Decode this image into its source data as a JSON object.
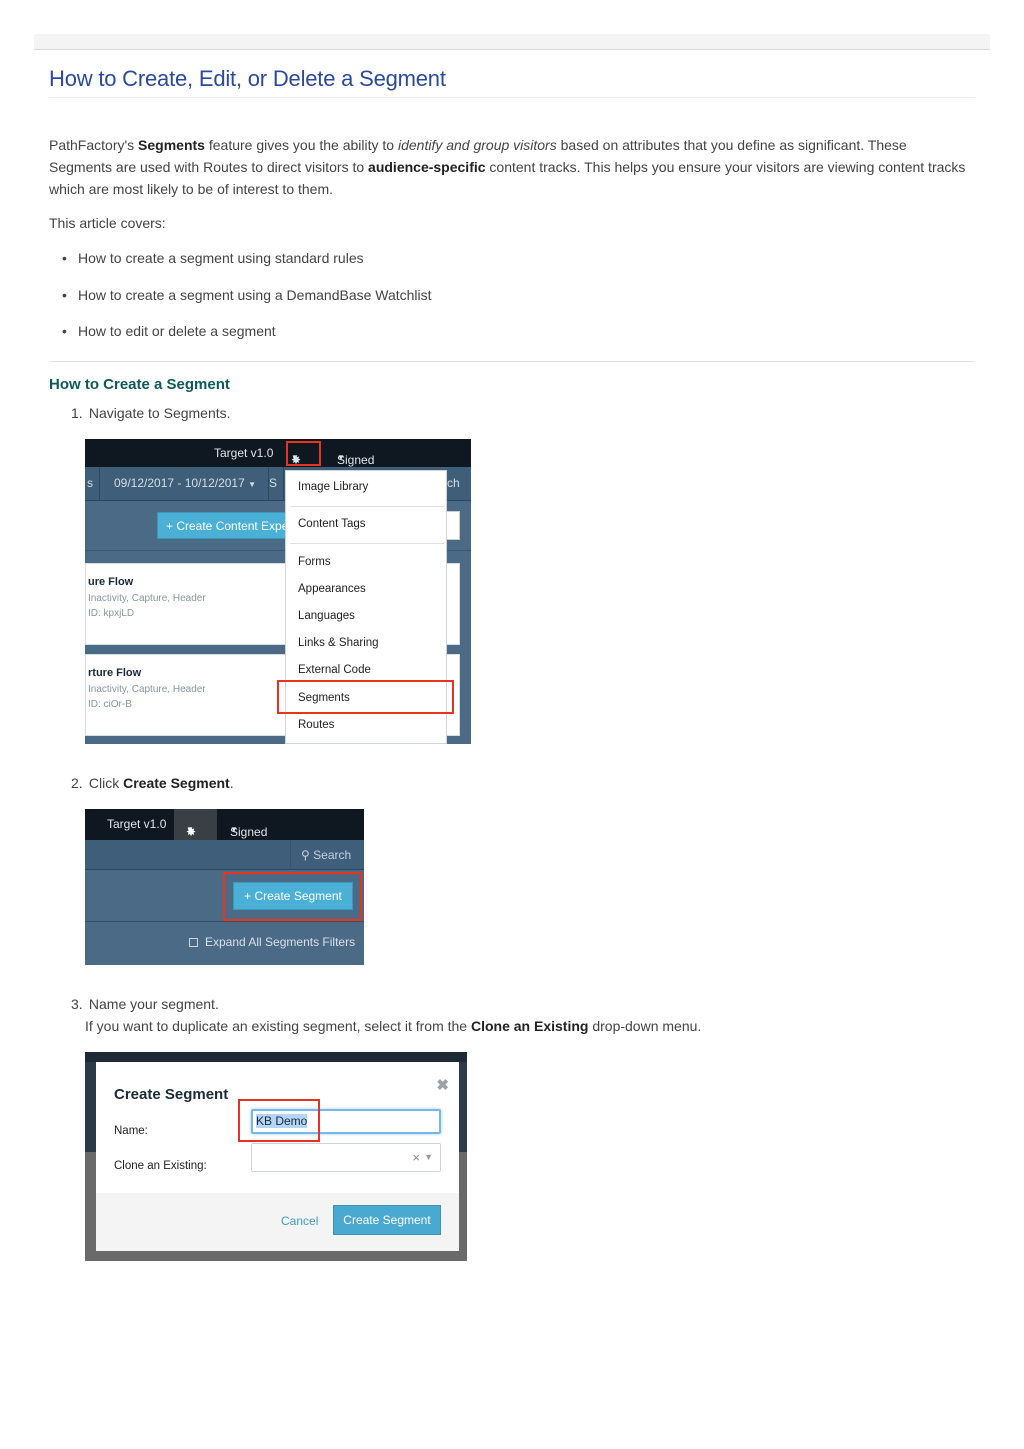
{
  "article": {
    "title": "How to Create, Edit, or Delete a Segment",
    "intro": {
      "t1": "PathFactory's ",
      "b1": "Segments",
      "t2": " feature gives you the ability to ",
      "i1": "identify and group visitors",
      "t3": " based on attributes that you define as significant. These Segments are used with Routes to direct visitors to ",
      "b2": "audience-specific",
      "t4": " content tracks. This helps you ensure your visitors are viewing content tracks which are most likely to be of interest to them."
    },
    "covers_label": "This article covers:",
    "covers": [
      "How to create a segment using standard rules",
      "How to create a segment using a DemandBase Watchlist",
      "How to edit or delete a segment"
    ],
    "section_title": "How to Create a Segment",
    "steps": [
      {
        "num": "1.",
        "text": "Navigate to Segments."
      },
      {
        "num": "2.",
        "pre": "Click ",
        "bold": "Create Segment",
        "post": "."
      },
      {
        "num": "3.",
        "text": "Name your segment.",
        "sub_pre": "If you want to duplicate an existing segment, select it from the ",
        "sub_bold": "Clone an Existing",
        "sub_post": " drop-down menu."
      }
    ]
  },
  "screenshot1": {
    "version": "Target v1.0",
    "signed_in": "Signed in as LuciaGB",
    "nav_partial": "s",
    "date_range": "09/12/2017 - 10/12/2017",
    "nav_partial2": "S",
    "nav_partial3": "ch",
    "create_button": "+ Create Content Expe",
    "cards": [
      {
        "name": "ure Flow",
        "tags": "Inactivity, Capture, Header",
        "id": "ID: kpxjLD"
      },
      {
        "name": "rture Flow",
        "tags": "Inactivity, Capture, Header",
        "id": "ID: ciOr-B"
      }
    ],
    "menu": [
      "Image Library",
      "Content Tags",
      "Forms",
      "Appearances",
      "Languages",
      "Links & Sharing",
      "External Code",
      "Segments",
      "Routes"
    ],
    "highlight_color": "#e8331e"
  },
  "screenshot2": {
    "version": "Target v1.0",
    "signed_in": "Signed in as LuciaGB",
    "search": "Search",
    "create_button": "+ Create Segment",
    "expand_label": "Expand All Segments Filters"
  },
  "screenshot3": {
    "modal_title": "Create Segment",
    "name_label": "Name:",
    "name_value": "KB Demo",
    "clone_label": "Clone an Existing:",
    "cancel": "Cancel",
    "submit": "Create Segment"
  }
}
